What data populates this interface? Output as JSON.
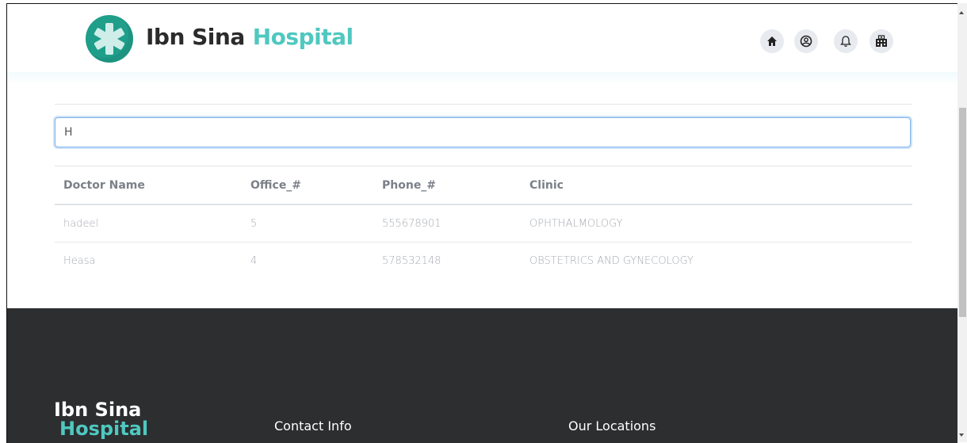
{
  "brand": {
    "name": "Ibn Sina",
    "accent": "Hospital"
  },
  "nav": [
    {
      "icon": "home-icon"
    },
    {
      "icon": "user-icon"
    },
    {
      "icon": "bell-icon"
    },
    {
      "icon": "hospital-icon"
    }
  ],
  "search": {
    "value": "H"
  },
  "table": {
    "headers": [
      "Doctor Name",
      "Office_#",
      "Phone_#",
      "Clinic"
    ],
    "rows": [
      [
        "hadeel",
        "5",
        "555678901",
        "OPHTHALMOLOGY"
      ],
      [
        "Heasa",
        "4",
        "578532148",
        "OBSTETRICS AND GYNECOLOGY"
      ]
    ]
  },
  "footer": {
    "logo_line1": "Ibn Sina",
    "logo_line2": "Hospital",
    "contact_title": "Contact Info",
    "locations_title": "Our Locations"
  },
  "colors": {
    "accent": "#4fc8c0",
    "logo_green": "#1f9e8a",
    "footer_bg": "#2c2e30"
  }
}
